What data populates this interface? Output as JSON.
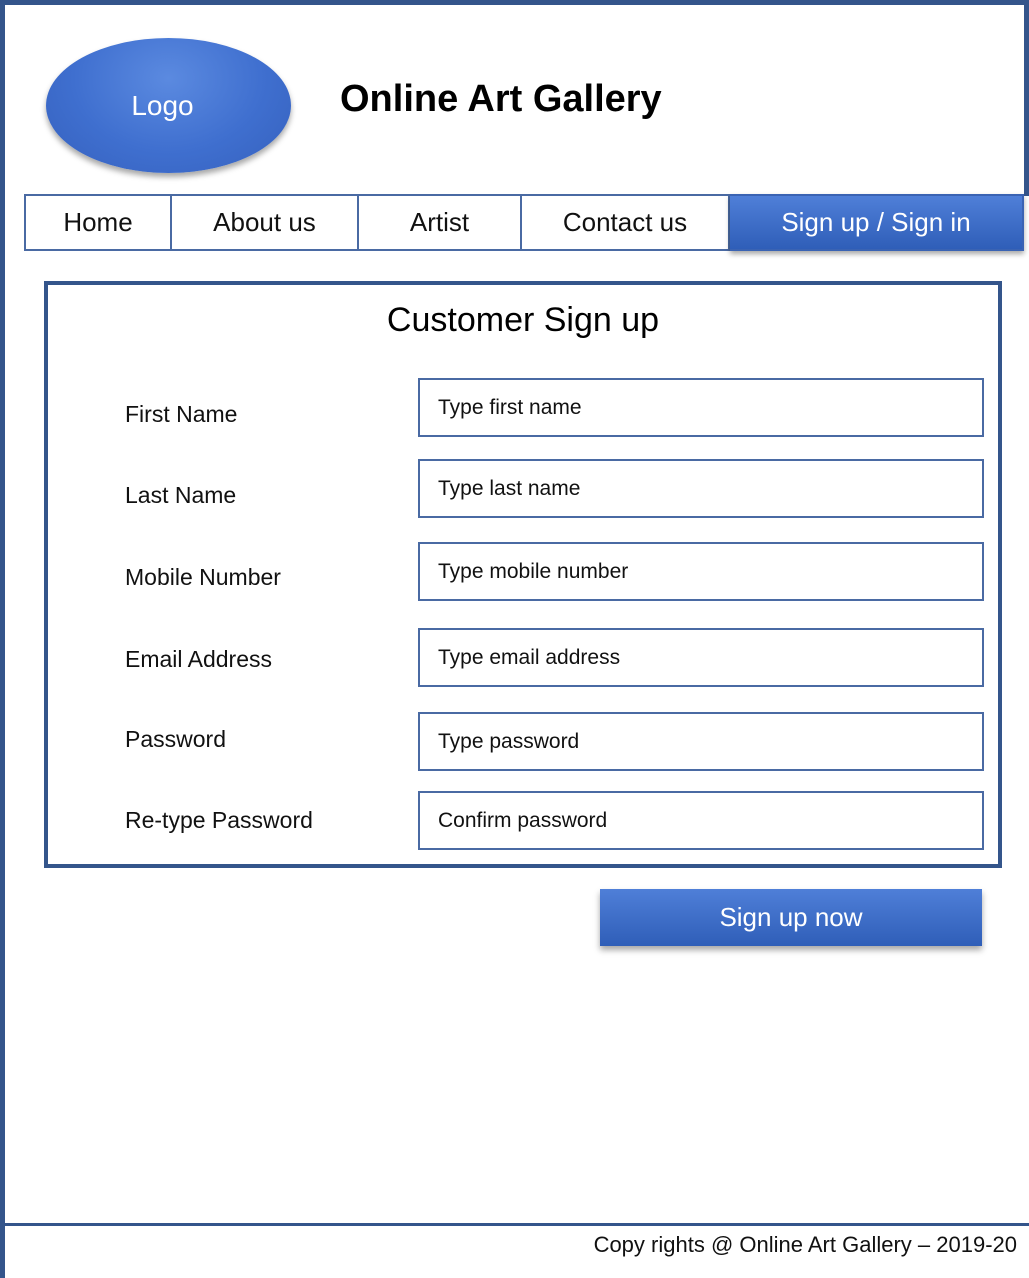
{
  "header": {
    "logo_text": "Logo",
    "site_title": "Online Art Gallery"
  },
  "nav": {
    "items": [
      {
        "label": "Home",
        "active": false
      },
      {
        "label": "About us",
        "active": false
      },
      {
        "label": "Artist",
        "active": false
      },
      {
        "label": "Contact us",
        "active": false
      },
      {
        "label": "Sign up / Sign in",
        "active": true
      }
    ]
  },
  "form": {
    "title": "Customer Sign up",
    "fields": [
      {
        "label": "First Name",
        "placeholder": "Type first name",
        "value": ""
      },
      {
        "label": "Last Name",
        "placeholder": "Type last name",
        "value": ""
      },
      {
        "label": "Mobile Number",
        "placeholder": "Type mobile number",
        "value": ""
      },
      {
        "label": "Email Address",
        "placeholder": "Type email address",
        "value": ""
      },
      {
        "label": "Password",
        "placeholder": "Type password",
        "value": ""
      },
      {
        "label": "Re-type Password",
        "placeholder": "Confirm password",
        "value": ""
      }
    ],
    "submit_label": "Sign up now"
  },
  "footer": {
    "text": "Copy rights @ Online Art Gallery – 2019-20"
  },
  "colors": {
    "accent": "#3a63b3",
    "border": "#34558b",
    "field_border": "#4a6aa3"
  }
}
